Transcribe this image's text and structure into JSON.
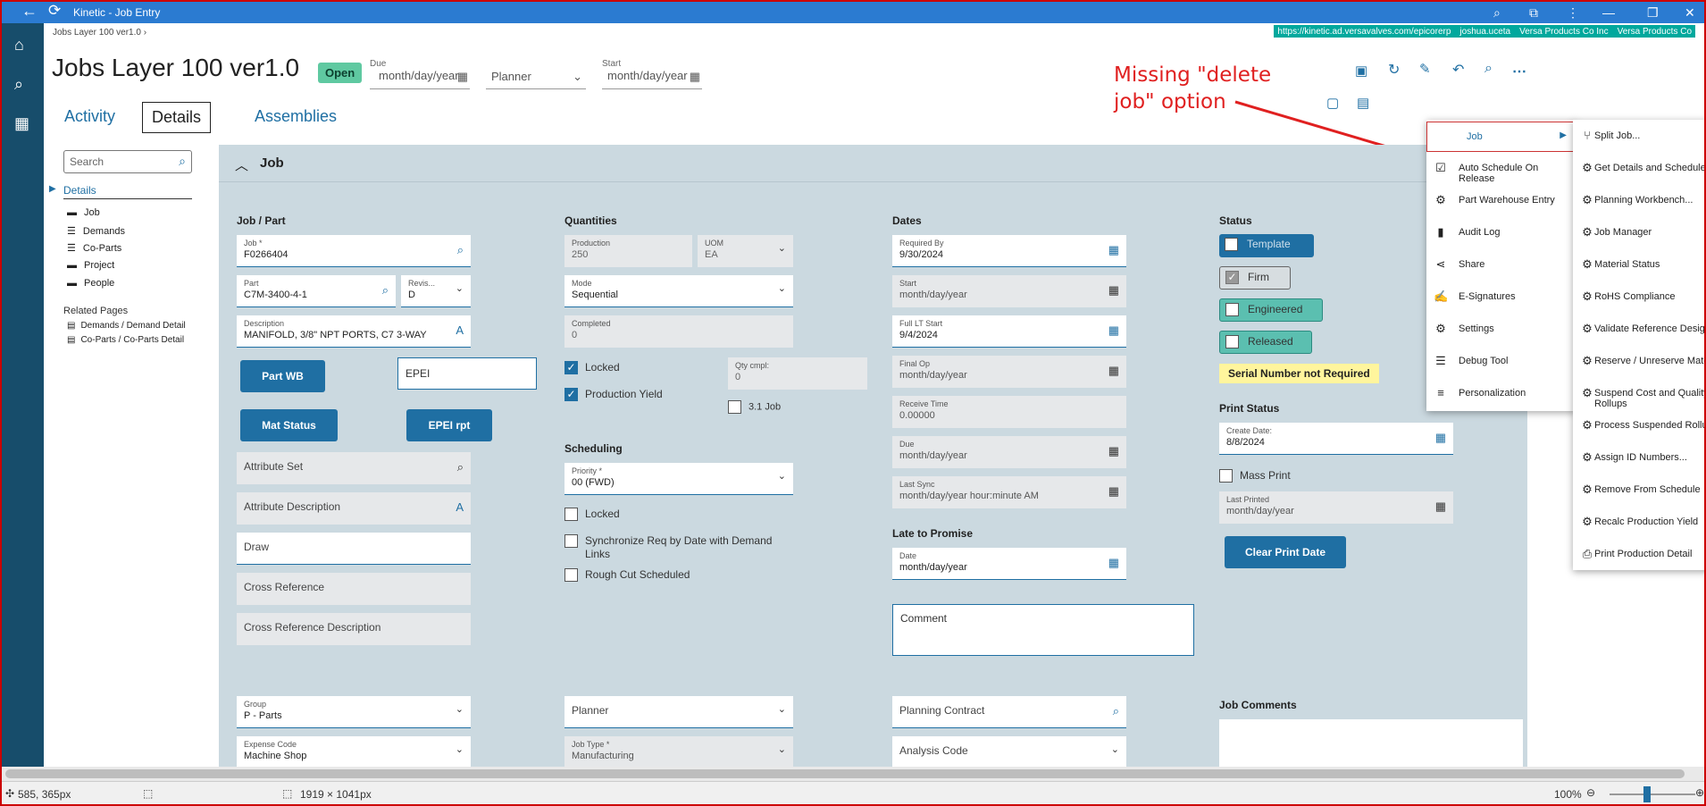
{
  "window": {
    "title": "Kinetic - Job Entry"
  },
  "urlbar": {
    "url": "https://kinetic.ad.versavalves.com/epicorerp",
    "user": "joshua.uceta",
    "company1": "Versa Products Co Inc",
    "company2": "Versa Products Co"
  },
  "page": {
    "breadcrumb": "Jobs Layer 100 ver1.0",
    "title": "Jobs Layer 100 ver1.0",
    "status_badge": "Open",
    "due_label": "Due",
    "due_value": "month/day/year",
    "planner_label": "Planner",
    "start_label": "Start",
    "start_value": "month/day/year"
  },
  "tabs": [
    "Activity",
    "Details",
    "Assemblies"
  ],
  "annotation": {
    "line1": "Missing \"delete",
    "line2": "job\" option"
  },
  "nav": {
    "search_placeholder": "Search",
    "details": "Details",
    "items": [
      "Job",
      "Demands",
      "Co-Parts",
      "Project",
      "People"
    ],
    "related_header": "Related Pages",
    "related": [
      "Demands / Demand Detail",
      "Co-Parts / Co-Parts Detail"
    ]
  },
  "section": {
    "title": "Job"
  },
  "jobpart": {
    "header": "Job / Part",
    "job_label": "Job *",
    "job_value": "F0266404",
    "part_label": "Part",
    "part_value": "C7M-3400-4-1",
    "rev_label": "Revis...",
    "rev_value": "D",
    "desc_label": "Description",
    "desc_value": "MANIFOLD, 3/8\" NPT PORTS, C7 3-WAY",
    "btn_partwb": "Part WB",
    "epei": "EPEI",
    "btn_matstatus": "Mat Status",
    "btn_epeirpt": "EPEI rpt",
    "attr_set": "Attribute Set",
    "attr_desc": "Attribute Description",
    "draw": "Draw",
    "crossref": "Cross Reference",
    "crossref_desc": "Cross Reference Description",
    "group_label": "Group",
    "group_value": "P - Parts",
    "expense_label": "Expense Code",
    "expense_value": "Machine Shop"
  },
  "quantities": {
    "header": "Quantities",
    "production_label": "Production",
    "production_value": "250",
    "uom_label": "UOM",
    "uom_value": "EA",
    "mode_label": "Mode",
    "mode_value": "Sequential",
    "completed_label": "Completed",
    "completed_value": "0",
    "locked": "Locked",
    "prod_yield": "Production Yield",
    "qtycmpl_label": "Qty cmpl:",
    "qtycmpl_value": "0",
    "job31": "3.1 Job"
  },
  "scheduling": {
    "header": "Scheduling",
    "priority_label": "Priority *",
    "priority_value": "00 (FWD)",
    "locked": "Locked",
    "sync_line1": "Synchronize Req by Date with Demand",
    "sync_line2": "Links",
    "roughcut": "Rough Cut Scheduled",
    "planner": "Planner",
    "jobtype_label": "Job Type *",
    "jobtype_value": "Manufacturing"
  },
  "dates": {
    "header": "Dates",
    "reqby_label": "Required By",
    "reqby_value": "9/30/2024",
    "start_label": "Start",
    "start_value": "month/day/year",
    "fullltstart_label": "Full LT Start",
    "fullltstart_value": "9/4/2024",
    "finalop_label": "Final Op",
    "finalop_value": "month/day/year",
    "receive_label": "Receive Time",
    "receive_value": "0.00000",
    "due_label": "Due",
    "due_value": "month/day/year",
    "lastsync_label": "Last Sync",
    "lastsync_value": "month/day/year hour:minute AM",
    "late_header": "Late to Promise",
    "date_label": "Date",
    "date_value": "month/day/year",
    "comment": "Comment",
    "planning_contract": "Planning Contract",
    "analysis_code": "Analysis Code"
  },
  "status": {
    "header": "Status",
    "template": "Template",
    "firm": "Firm",
    "engineered": "Engineered",
    "released": "Released",
    "serial_note": "Serial Number not Required",
    "print_header": "Print Status",
    "create_label": "Create Date:",
    "create_value": "8/8/2024",
    "mass_print": "Mass Print",
    "lastprinted_label": "Last Printed",
    "lastprinted_value": "month/day/year",
    "btn_clear": "Clear Print Date",
    "job_comments": "Job Comments"
  },
  "popup": {
    "job": "Job",
    "items": [
      "Auto Schedule On Release",
      "Part Warehouse Entry",
      "Audit Log",
      "Share",
      "E-Signatures",
      "Settings",
      "Debug Tool",
      "Personalization"
    ]
  },
  "submenu": [
    "Split Job...",
    "Get Details and Schedule...",
    "Planning Workbench...",
    "Job Manager",
    "Material Status",
    "RoHS Compliance",
    "Validate Reference Designators",
    "Reserve / Unreserve Material...",
    "Suspend Cost and Quality Rollups",
    "Process Suspended Rollups",
    "Assign ID Numbers...",
    "Remove From Schedule",
    "Recalc Production Yield",
    "Print Production Detail"
  ],
  "statusbar": {
    "cursor": "585, 365px",
    "size": "1919 × 1041px",
    "zoom": "100%"
  }
}
